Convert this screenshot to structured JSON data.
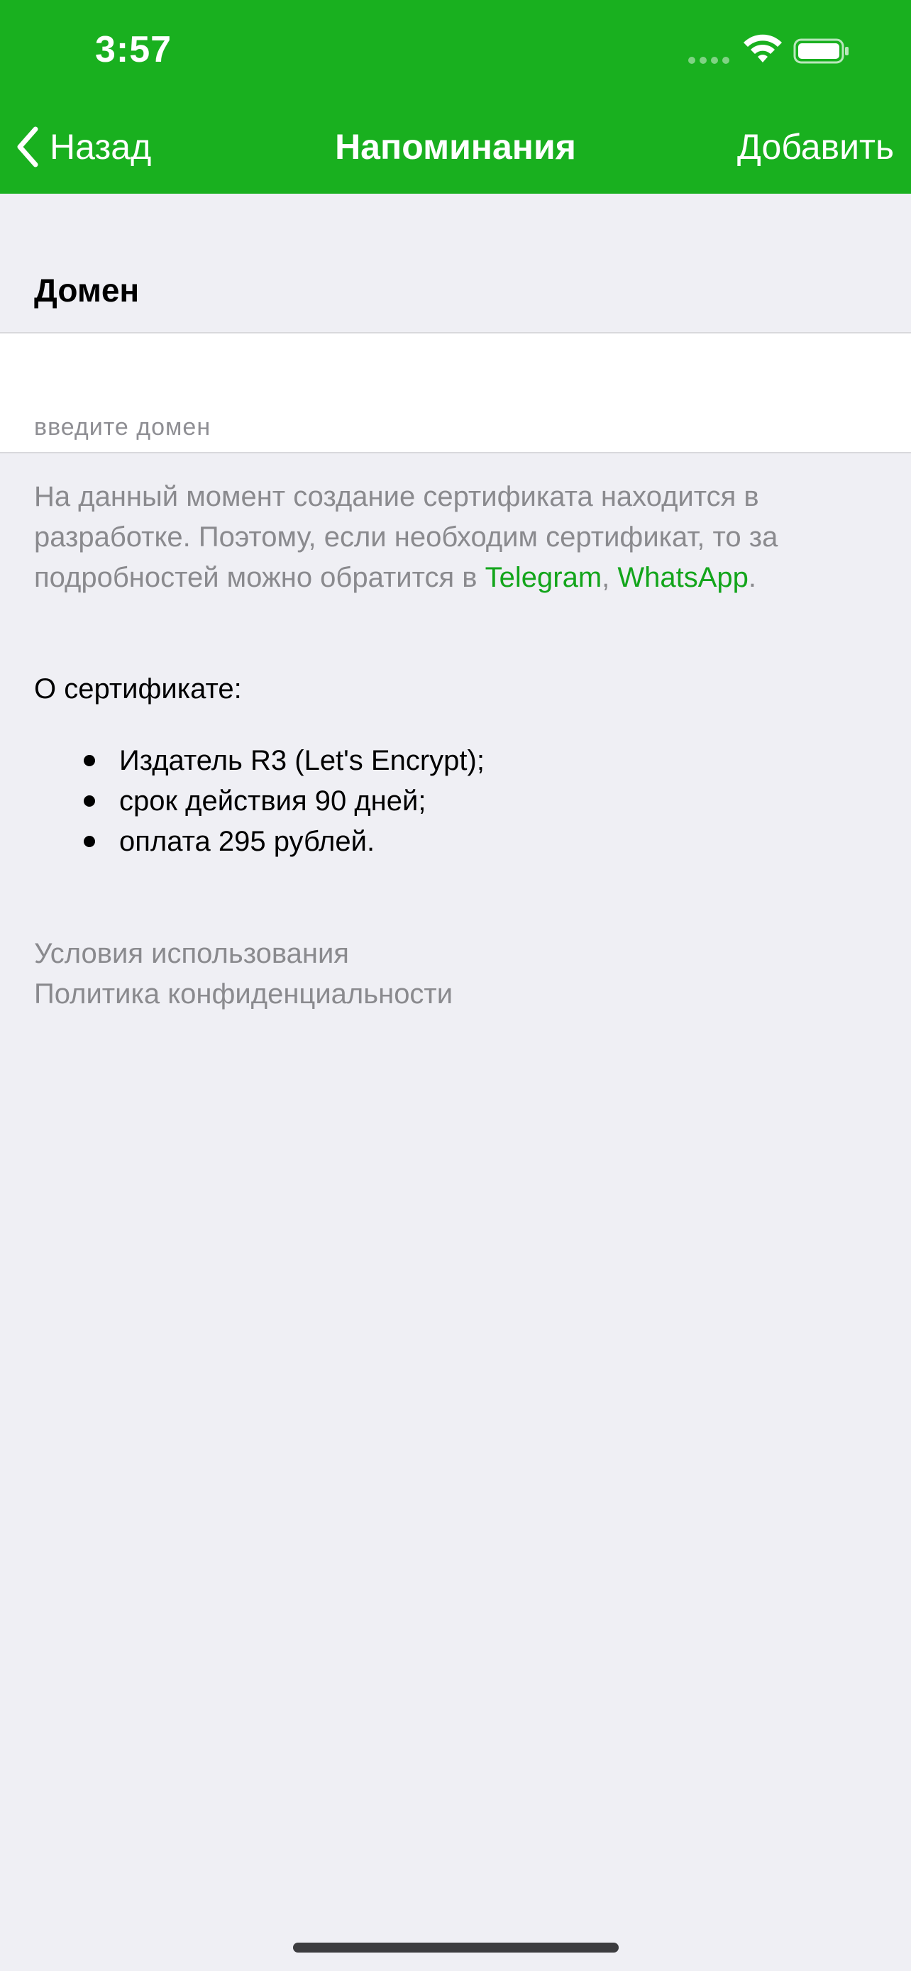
{
  "colors": {
    "header_bg": "#19b01f",
    "link": "#13a51b",
    "page_bg": "#efeff4"
  },
  "status_bar": {
    "time": "3:57",
    "icons": [
      "cellular-icon",
      "wifi-icon",
      "battery-icon"
    ]
  },
  "nav": {
    "back_label": "Назад",
    "title": "Напоминания",
    "add_label": "Добавить"
  },
  "domain_section": {
    "title": "Домен",
    "input_value": "",
    "placeholder": "введите домен"
  },
  "info": {
    "text_before": "На данный момент создание сертификата находится в разработке. Поэтому, если необходим сертификат, то за подробностей можно обратится в ",
    "link_telegram": "Telegram",
    "separator": ", ",
    "link_whatsapp": "WhatsApp",
    "text_after": "."
  },
  "about": {
    "heading": "О сертификате:",
    "items": [
      "Издатель R3 (Let's Encrypt);",
      "срок действия 90 дней;",
      "оплата 295 рублей."
    ]
  },
  "legal": {
    "terms": "Условия использования",
    "privacy": "Политика конфиденциальности"
  }
}
